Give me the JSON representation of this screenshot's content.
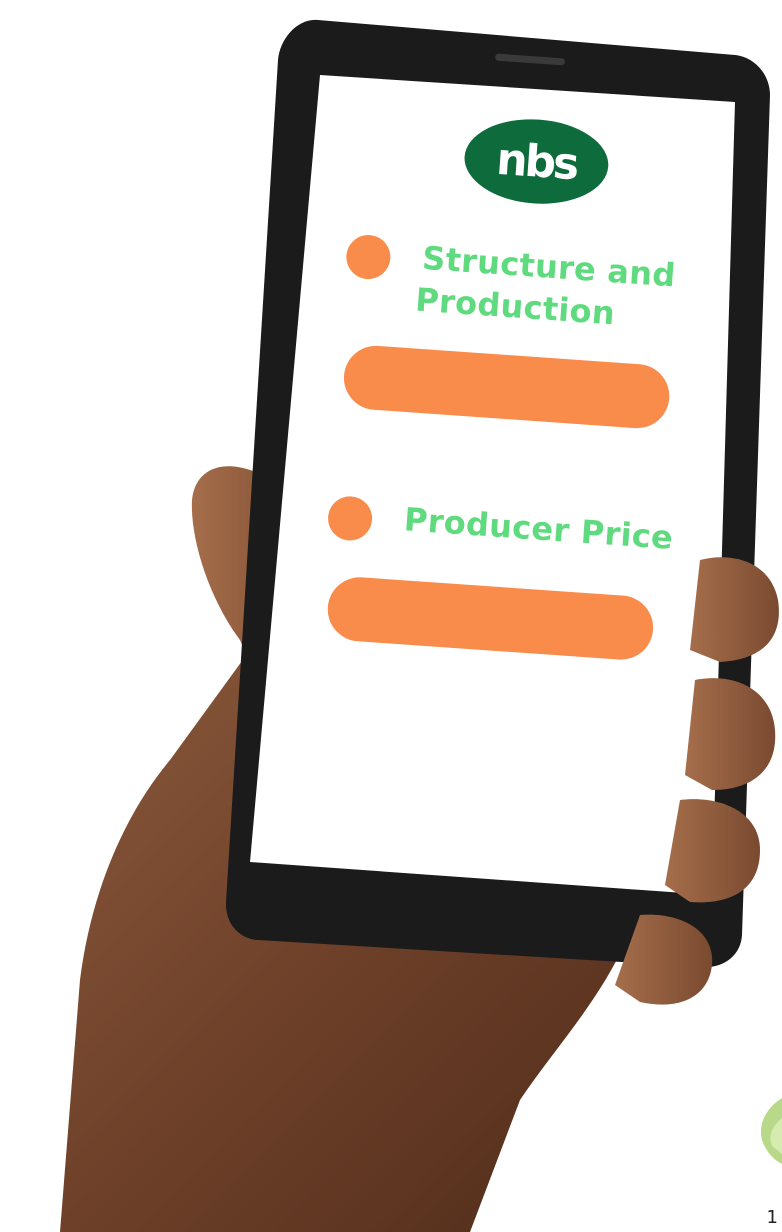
{
  "brand": {
    "logo_text": "nbs",
    "logo_color": "#0e6b3b"
  },
  "sections": [
    {
      "label_line1": "Structure and",
      "label_line2": "Production"
    },
    {
      "label": "Producer Price"
    }
  ],
  "colors": {
    "accent_orange": "#f98b4b",
    "label_green": "#5fda7e",
    "screen_bg": "#ffffff",
    "phone_body": "#1b1b1b"
  },
  "icons": {
    "corner_leaf": "leaf-icon"
  },
  "corner_text": "1"
}
